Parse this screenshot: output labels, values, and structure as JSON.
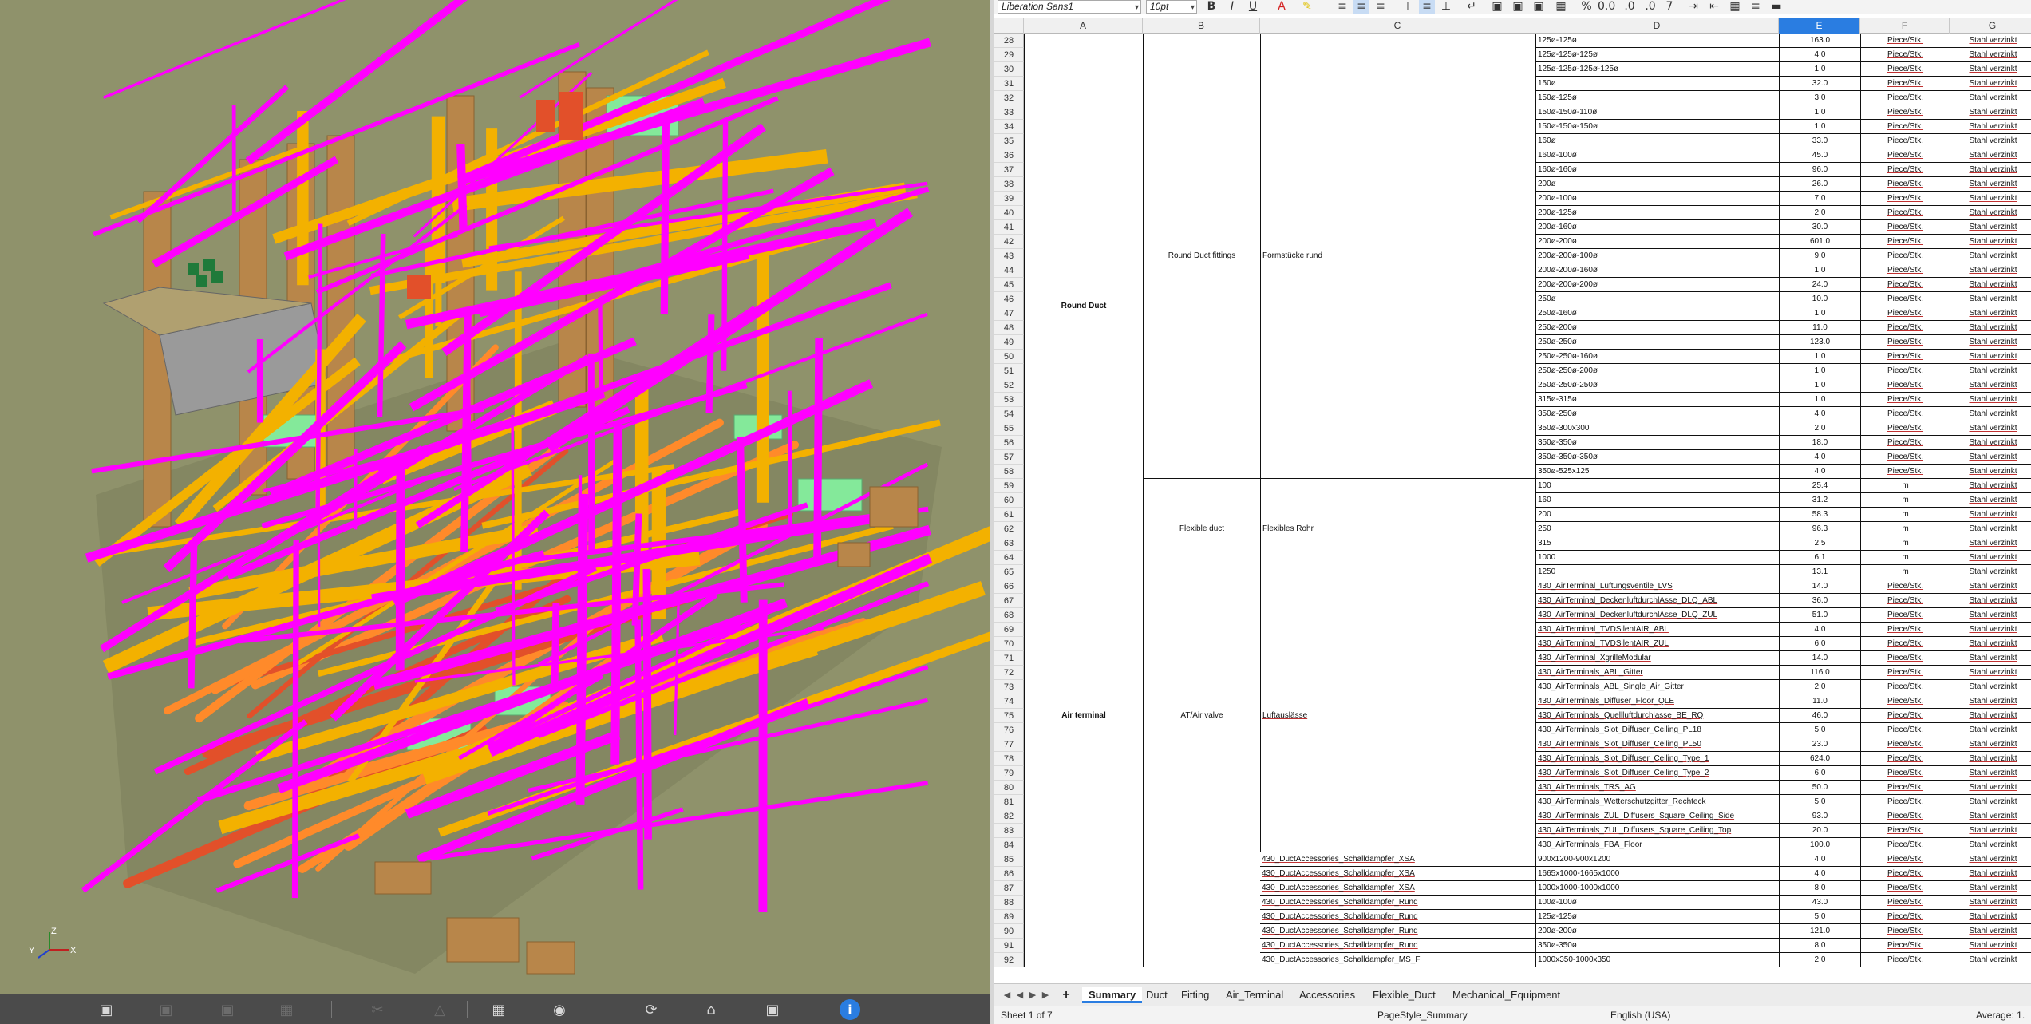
{
  "viewer": {
    "toolbar_icons": [
      "orbit-icon",
      "pan-icon",
      "zoom-icon",
      "fit-icon",
      "section-icon",
      "measure-icon",
      "grid-icon",
      "camera-icon",
      "rotate-icon",
      "home-icon",
      "focus-icon",
      "info-icon"
    ],
    "axis": {
      "x": "X",
      "y": "Y",
      "z": "Z"
    },
    "colors": {
      "background": "#8f926b",
      "magenta": "#ff00ff",
      "yellow": "#f3b100",
      "brown": "#b8864a",
      "green": "#84e99a",
      "orange": "#ff8a2a",
      "gray": "#9a9a9a"
    }
  },
  "spreadsheet": {
    "font_name": "Liberation Sans1",
    "font_size": "10pt",
    "columns": [
      "A",
      "B",
      "C",
      "D",
      "E",
      "F",
      "G"
    ],
    "selected_column": "E",
    "groups": {
      "round_duct": "Round Duct",
      "round_duct_fittings": "Round Duct fittings",
      "formstuecke": "Formstücke rund",
      "flexible_duct": "Flexible duct",
      "flexibles_rohr": "Flexibles Rohr",
      "air_terminal": "Air terminal",
      "at_air_valve": "AT/Air valve",
      "luftauslaesse": "Luftauslässe"
    },
    "rows": [
      {
        "n": "28",
        "d": "125ø-125ø",
        "e": "163.0",
        "f": "Piece/Stk.",
        "g": "Stahl verzinkt"
      },
      {
        "n": "29",
        "d": "125ø-125ø-125ø",
        "e": "4.0",
        "f": "Piece/Stk.",
        "g": "Stahl verzinkt"
      },
      {
        "n": "30",
        "d": "125ø-125ø-125ø-125ø",
        "e": "1.0",
        "f": "Piece/Stk.",
        "g": "Stahl verzinkt"
      },
      {
        "n": "31",
        "d": "150ø",
        "e": "32.0",
        "f": "Piece/Stk.",
        "g": "Stahl verzinkt"
      },
      {
        "n": "32",
        "d": "150ø-125ø",
        "e": "3.0",
        "f": "Piece/Stk.",
        "g": "Stahl verzinkt"
      },
      {
        "n": "33",
        "d": "150ø-150ø-110ø",
        "e": "1.0",
        "f": "Piece/Stk.",
        "g": "Stahl verzinkt"
      },
      {
        "n": "34",
        "d": "150ø-150ø-150ø",
        "e": "1.0",
        "f": "Piece/Stk.",
        "g": "Stahl verzinkt"
      },
      {
        "n": "35",
        "d": "160ø",
        "e": "33.0",
        "f": "Piece/Stk.",
        "g": "Stahl verzinkt"
      },
      {
        "n": "36",
        "d": "160ø-100ø",
        "e": "45.0",
        "f": "Piece/Stk.",
        "g": "Stahl verzinkt"
      },
      {
        "n": "37",
        "d": "160ø-160ø",
        "e": "96.0",
        "f": "Piece/Stk.",
        "g": "Stahl verzinkt"
      },
      {
        "n": "38",
        "d": "200ø",
        "e": "26.0",
        "f": "Piece/Stk.",
        "g": "Stahl verzinkt"
      },
      {
        "n": "39",
        "d": "200ø-100ø",
        "e": "7.0",
        "f": "Piece/Stk.",
        "g": "Stahl verzinkt"
      },
      {
        "n": "40",
        "d": "200ø-125ø",
        "e": "2.0",
        "f": "Piece/Stk.",
        "g": "Stahl verzinkt"
      },
      {
        "n": "41",
        "d": "200ø-160ø",
        "e": "30.0",
        "f": "Piece/Stk.",
        "g": "Stahl verzinkt"
      },
      {
        "n": "42",
        "d": "200ø-200ø",
        "e": "601.0",
        "f": "Piece/Stk.",
        "g": "Stahl verzinkt"
      },
      {
        "n": "43",
        "d": "200ø-200ø-100ø",
        "e": "9.0",
        "f": "Piece/Stk.",
        "g": "Stahl verzinkt"
      },
      {
        "n": "44",
        "d": "200ø-200ø-160ø",
        "e": "1.0",
        "f": "Piece/Stk.",
        "g": "Stahl verzinkt"
      },
      {
        "n": "45",
        "d": "200ø-200ø-200ø",
        "e": "24.0",
        "f": "Piece/Stk.",
        "g": "Stahl verzinkt"
      },
      {
        "n": "46",
        "d": "250ø",
        "e": "10.0",
        "f": "Piece/Stk.",
        "g": "Stahl verzinkt"
      },
      {
        "n": "47",
        "d": "250ø-160ø",
        "e": "1.0",
        "f": "Piece/Stk.",
        "g": "Stahl verzinkt"
      },
      {
        "n": "48",
        "d": "250ø-200ø",
        "e": "11.0",
        "f": "Piece/Stk.",
        "g": "Stahl verzinkt"
      },
      {
        "n": "49",
        "d": "250ø-250ø",
        "e": "123.0",
        "f": "Piece/Stk.",
        "g": "Stahl verzinkt"
      },
      {
        "n": "50",
        "d": "250ø-250ø-160ø",
        "e": "1.0",
        "f": "Piece/Stk.",
        "g": "Stahl verzinkt"
      },
      {
        "n": "51",
        "d": "250ø-250ø-200ø",
        "e": "1.0",
        "f": "Piece/Stk.",
        "g": "Stahl verzinkt"
      },
      {
        "n": "52",
        "d": "250ø-250ø-250ø",
        "e": "1.0",
        "f": "Piece/Stk.",
        "g": "Stahl verzinkt"
      },
      {
        "n": "53",
        "d": "315ø-315ø",
        "e": "1.0",
        "f": "Piece/Stk.",
        "g": "Stahl verzinkt"
      },
      {
        "n": "54",
        "d": "350ø-250ø",
        "e": "4.0",
        "f": "Piece/Stk.",
        "g": "Stahl verzinkt"
      },
      {
        "n": "55",
        "d": "350ø-300x300",
        "e": "2.0",
        "f": "Piece/Stk.",
        "g": "Stahl verzinkt"
      },
      {
        "n": "56",
        "d": "350ø-350ø",
        "e": "18.0",
        "f": "Piece/Stk.",
        "g": "Stahl verzinkt"
      },
      {
        "n": "57",
        "d": "350ø-350ø-350ø",
        "e": "4.0",
        "f": "Piece/Stk.",
        "g": "Stahl verzinkt"
      },
      {
        "n": "58",
        "d": "350ø-525x125",
        "e": "4.0",
        "f": "Piece/Stk.",
        "g": "Stahl verzinkt"
      },
      {
        "n": "59",
        "d": "100",
        "e": "25.4",
        "f": "m",
        "g": "Stahl verzinkt"
      },
      {
        "n": "60",
        "d": "160",
        "e": "31.2",
        "f": "m",
        "g": "Stahl verzinkt"
      },
      {
        "n": "61",
        "d": "200",
        "e": "58.3",
        "f": "m",
        "g": "Stahl verzinkt"
      },
      {
        "n": "62",
        "d": "250",
        "e": "96.3",
        "f": "m",
        "g": "Stahl verzinkt"
      },
      {
        "n": "63",
        "d": "315",
        "e": "2.5",
        "f": "m",
        "g": "Stahl verzinkt"
      },
      {
        "n": "64",
        "d": "1000",
        "e": "6.1",
        "f": "m",
        "g": "Stahl verzinkt"
      },
      {
        "n": "65",
        "d": "1250",
        "e": "13.1",
        "f": "m",
        "g": "Stahl verzinkt"
      },
      {
        "n": "66",
        "d": "430_AirTerminal_Luftungsventile_LVS",
        "e": "14.0",
        "f": "Piece/Stk.",
        "g": "Stahl verzinkt"
      },
      {
        "n": "67",
        "d": "430_AirTerminal_DeckenluftdurchlAsse_DLQ_ABL",
        "e": "36.0",
        "f": "Piece/Stk.",
        "g": "Stahl verzinkt"
      },
      {
        "n": "68",
        "d": "430_AirTerminal_DeckenluftdurchlAsse_DLQ_ZUL",
        "e": "51.0",
        "f": "Piece/Stk.",
        "g": "Stahl verzinkt"
      },
      {
        "n": "69",
        "d": "430_AirTerminal_TVDSilentAIR_ABL",
        "e": "4.0",
        "f": "Piece/Stk.",
        "g": "Stahl verzinkt"
      },
      {
        "n": "70",
        "d": "430_AirTerminal_TVDSilentAIR_ZUL",
        "e": "6.0",
        "f": "Piece/Stk.",
        "g": "Stahl verzinkt"
      },
      {
        "n": "71",
        "d": "430_AirTerminal_XgrilleModular",
        "e": "14.0",
        "f": "Piece/Stk.",
        "g": "Stahl verzinkt"
      },
      {
        "n": "72",
        "d": "430_AirTerminals_ABL_Gitter",
        "e": "116.0",
        "f": "Piece/Stk.",
        "g": "Stahl verzinkt"
      },
      {
        "n": "73",
        "d": "430_AirTerminals_ABL_Single_Air_Gitter",
        "e": "2.0",
        "f": "Piece/Stk.",
        "g": "Stahl verzinkt"
      },
      {
        "n": "74",
        "d": "430_AirTerminals_Diffuser_Floor_QLE",
        "e": "11.0",
        "f": "Piece/Stk.",
        "g": "Stahl verzinkt"
      },
      {
        "n": "75",
        "d": "430_AirTerminals_Quellluftdurchlasse_BE_RQ",
        "e": "46.0",
        "f": "Piece/Stk.",
        "g": "Stahl verzinkt"
      },
      {
        "n": "76",
        "d": "430_AirTerminals_Slot_Diffuser_Ceiling_PL18",
        "e": "5.0",
        "f": "Piece/Stk.",
        "g": "Stahl verzinkt"
      },
      {
        "n": "77",
        "d": "430_AirTerminals_Slot_Diffuser_Ceiling_PL50",
        "e": "23.0",
        "f": "Piece/Stk.",
        "g": "Stahl verzinkt"
      },
      {
        "n": "78",
        "d": "430_AirTerminals_Slot_Diffuser_Ceiling_Type_1",
        "e": "624.0",
        "f": "Piece/Stk.",
        "g": "Stahl verzinkt"
      },
      {
        "n": "79",
        "d": "430_AirTerminals_Slot_Diffuser_Ceiling_Type_2",
        "e": "6.0",
        "f": "Piece/Stk.",
        "g": "Stahl verzinkt"
      },
      {
        "n": "80",
        "d": "430_AirTerminals_TRS_AG",
        "e": "50.0",
        "f": "Piece/Stk.",
        "g": "Stahl verzinkt"
      },
      {
        "n": "81",
        "d": "430_AirTerminals_Wetterschutzgitter_Rechteck",
        "e": "5.0",
        "f": "Piece/Stk.",
        "g": "Stahl verzinkt"
      },
      {
        "n": "82",
        "d": "430_AirTerminals_ZUL_Diffusers_Square_Ceiling_Side",
        "e": "93.0",
        "f": "Piece/Stk.",
        "g": "Stahl verzinkt"
      },
      {
        "n": "83",
        "d": "430_AirTerminals_ZUL_Diffusers_Square_Ceiling_Top",
        "e": "20.0",
        "f": "Piece/Stk.",
        "g": "Stahl verzinkt"
      },
      {
        "n": "84",
        "d": "430_AirTerminals_FBA_Floor",
        "e": "100.0",
        "f": "Piece/Stk.",
        "g": "Stahl verzinkt"
      },
      {
        "n": "85",
        "c": "430_DuctAccessories_Schalldampfer_XSA",
        "d": "900x1200-900x1200",
        "e": "4.0",
        "f": "Piece/Stk.",
        "g": "Stahl verzinkt"
      },
      {
        "n": "86",
        "c": "430_DuctAccessories_Schalldampfer_XSA",
        "d": "1665x1000-1665x1000",
        "e": "4.0",
        "f": "Piece/Stk.",
        "g": "Stahl verzinkt"
      },
      {
        "n": "87",
        "c": "430_DuctAccessories_Schalldampfer_XSA",
        "d": "1000x1000-1000x1000",
        "e": "8.0",
        "f": "Piece/Stk.",
        "g": "Stahl verzinkt"
      },
      {
        "n": "88",
        "c": "430_DuctAccessories_Schalldampfer_Rund",
        "d": "100ø-100ø",
        "e": "43.0",
        "f": "Piece/Stk.",
        "g": "Stahl verzinkt"
      },
      {
        "n": "89",
        "c": "430_DuctAccessories_Schalldampfer_Rund",
        "d": "125ø-125ø",
        "e": "5.0",
        "f": "Piece/Stk.",
        "g": "Stahl verzinkt"
      },
      {
        "n": "90",
        "c": "430_DuctAccessories_Schalldampfer_Rund",
        "d": "200ø-200ø",
        "e": "121.0",
        "f": "Piece/Stk.",
        "g": "Stahl verzinkt"
      },
      {
        "n": "91",
        "c": "430_DuctAccessories_Schalldampfer_Rund",
        "d": "350ø-350ø",
        "e": "8.0",
        "f": "Piece/Stk.",
        "g": "Stahl verzinkt"
      },
      {
        "n": "92",
        "c": "430_DuctAccessories_Schalldampfer_MS_F",
        "d": "1000x350-1000x350",
        "e": "2.0",
        "f": "Piece/Stk.",
        "g": "Stahl verzinkt"
      }
    ],
    "tabs": [
      "Summary",
      "Duct",
      "Fitting",
      "Air_Terminal",
      "Accessories",
      "Flexible_Duct",
      "Mechanical_Equipment"
    ],
    "active_tab": "Summary",
    "status": {
      "sheet": "Sheet 1 of 7",
      "page_style": "PageStyle_Summary",
      "language": "English (USA)",
      "average": "Average: 1."
    }
  }
}
